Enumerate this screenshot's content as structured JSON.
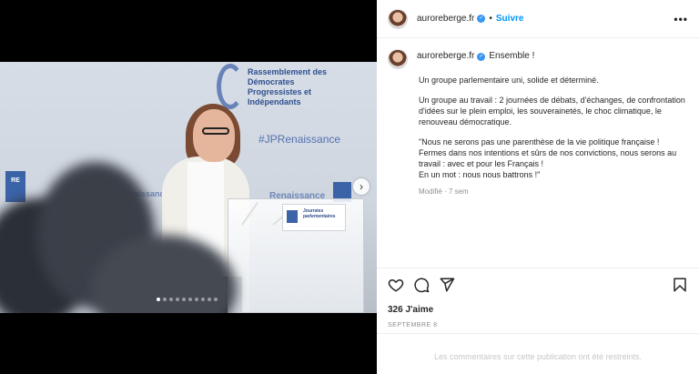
{
  "media": {
    "backdrop_title": "Rassemblement des Démocrates Progressistes et Indépendants",
    "backdrop_hashtag": "#JPRenaissance",
    "backdrop_renaissance_left": "naissance",
    "backdrop_renaissance_right": "Renaissance",
    "badge_text": "RE",
    "lectern_title": "Journées parlementaires",
    "next_glyph": "›",
    "carousel_count": 10,
    "carousel_active": 0
  },
  "post": {
    "author": "auroreberge.fr",
    "verified_icon": "✓",
    "follow_separator": "•",
    "follow_label": "Suivre",
    "more_label": "•••",
    "caption_title": "Ensemble !",
    "caption_paragraphs": [
      "Un groupe parlementaire uni, solide et déterminé.",
      "Un groupe au travail : 2 journées de débats, d'échanges, de confrontation d'idées sur le plein emploi, les souverainetés, le choc climatique, le renouveau démocratique.",
      "\"Nous ne serons pas une parenthèse de la vie politique française !\nFermes dans nos intentions et sûrs de nos convictions, nous serons au travail : avec et pour les Français !\nEn un mot : nous nous battrons !\""
    ],
    "modified": "Modifié · 7 sem",
    "likes": "326 J'aime",
    "date": "SEPTEMBRE 8",
    "comments_restricted": "Les commentaires sur cette publication ont été restreints."
  },
  "colors": {
    "accent": "#0095f6",
    "verified": "#3897f0",
    "brand_blue": "#3b63a8"
  },
  "icons": [
    "heart-icon",
    "comment-icon",
    "share-icon",
    "bookmark-icon",
    "chevron-right-icon",
    "more-icon",
    "verified-icon"
  ]
}
